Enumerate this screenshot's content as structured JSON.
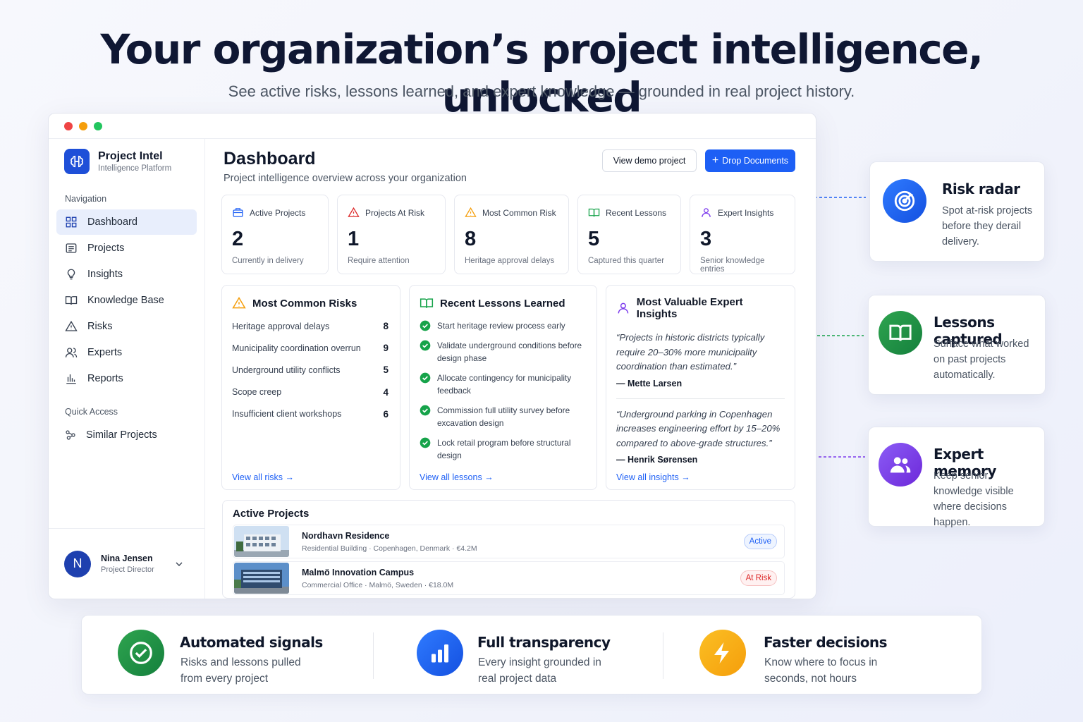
{
  "hero": {
    "title": "Your organization’s project intelligence, unlocked",
    "subtitle": "See active risks, lessons learned, and expert knowledge — grounded in real project history."
  },
  "app": {
    "brand_name": "Project Intel",
    "brand_sub": "Intelligence Platform",
    "nav_label": "Navigation",
    "nav_items": [
      {
        "label": "Dashboard",
        "icon": "grid-icon",
        "active": true
      },
      {
        "label": "Projects",
        "icon": "list-icon"
      },
      {
        "label": "Insights",
        "icon": "lightbulb-icon"
      },
      {
        "label": "Knowledge Base",
        "icon": "book-icon"
      },
      {
        "label": "Risks",
        "icon": "warning-icon"
      },
      {
        "label": "Experts",
        "icon": "users-icon"
      },
      {
        "label": "Reports",
        "icon": "bar-chart-icon"
      }
    ],
    "quick_label": "Quick Access",
    "quick_items": [
      {
        "label": "Similar Projects",
        "icon": "link-nodes-icon"
      }
    ],
    "user": {
      "initial": "N",
      "name": "Nina Jensen",
      "role": "Project Director"
    }
  },
  "dashboard": {
    "title": "Dashboard",
    "subtitle": "Project intelligence overview across your organization",
    "demo_button": "View demo project",
    "drop_button": "Drop Documents",
    "stats": [
      {
        "label": "Active Projects",
        "value": "2",
        "desc": "Currently in delivery",
        "icon": "briefcase-icon",
        "color": "#1d5ff5"
      },
      {
        "label": "Projects At Risk",
        "value": "1",
        "desc": "Require attention",
        "icon": "warning-icon",
        "color": "#dc2626"
      },
      {
        "label": "Most Common Risk",
        "value": "8",
        "desc": "Heritage approval delays",
        "icon": "warning-icon",
        "color": "#f59e0b"
      },
      {
        "label": "Recent Lessons",
        "value": "5",
        "desc": "Captured this quarter",
        "icon": "book-icon",
        "color": "#16a34a"
      },
      {
        "label": "Expert Insights",
        "value": "3",
        "desc": "Senior knowledge entries",
        "icon": "user-icon",
        "color": "#7c3aed"
      }
    ],
    "risks": {
      "title": "Most Common Risks",
      "items": [
        {
          "name": "Heritage approval delays",
          "count": "8"
        },
        {
          "name": "Municipality coordination overrun",
          "count": "9"
        },
        {
          "name": "Underground utility conflicts",
          "count": "5"
        },
        {
          "name": "Scope creep",
          "count": "4"
        },
        {
          "name": "Insufficient client workshops",
          "count": "6"
        }
      ],
      "link": "View all risks"
    },
    "lessons": {
      "title": "Recent Lessons Learned",
      "items": [
        "Start heritage review process early",
        "Validate underground conditions before design phase",
        "Allocate contingency for municipality feedback",
        "Commission full utility survey before excavation design",
        "Lock retail program before structural design"
      ],
      "link": "View all lessons"
    },
    "insights": {
      "title": "Most Valuable Expert Insights",
      "quotes": [
        {
          "text": "“Projects in historic districts typically require 20–30% more municipality coordination than estimated.”",
          "author": "— Mette Larsen"
        },
        {
          "text": "“Underground parking in Copenhagen increases engineering effort by 15–20% compared to above-grade structures.”",
          "author": "— Henrik Sørensen"
        }
      ],
      "link": "View all insights"
    },
    "active_projects": {
      "title": "Active Projects",
      "items": [
        {
          "name": "Nordhavn Residence",
          "meta": "Residential Building · Copenhagen, Denmark · €4.2M",
          "status": "Active"
        },
        {
          "name": "Malmö Innovation Campus",
          "meta": "Commercial Office · Malmö, Sweden · €18.0M",
          "status": "At Risk"
        }
      ]
    }
  },
  "callouts": [
    {
      "title": "Risk radar",
      "text": "Spot at-risk projects before they derail delivery.",
      "icon": "target-icon",
      "color": "#1d5ff5"
    },
    {
      "title": "Lessons captured",
      "text": "Surface what worked on past projects automatically.",
      "icon": "book-icon",
      "color": "#16a34a"
    },
    {
      "title": "Expert memory",
      "text": "Keep senior knowledge visible where decisions happen.",
      "icon": "users-icon",
      "color": "#7c3aed"
    }
  ],
  "features": [
    {
      "title": "Automated signals",
      "text": "Risks and lessons pulled from every project",
      "icon": "check-circle-icon",
      "color": "#16a34a"
    },
    {
      "title": "Full transparency",
      "text": "Every insight grounded in real project data",
      "icon": "bar-chart-icon",
      "color": "#1d5ff5"
    },
    {
      "title": "Faster decisions",
      "text": "Know where to focus in seconds, not hours",
      "icon": "lightning-icon",
      "color": "#f5b014"
    }
  ]
}
